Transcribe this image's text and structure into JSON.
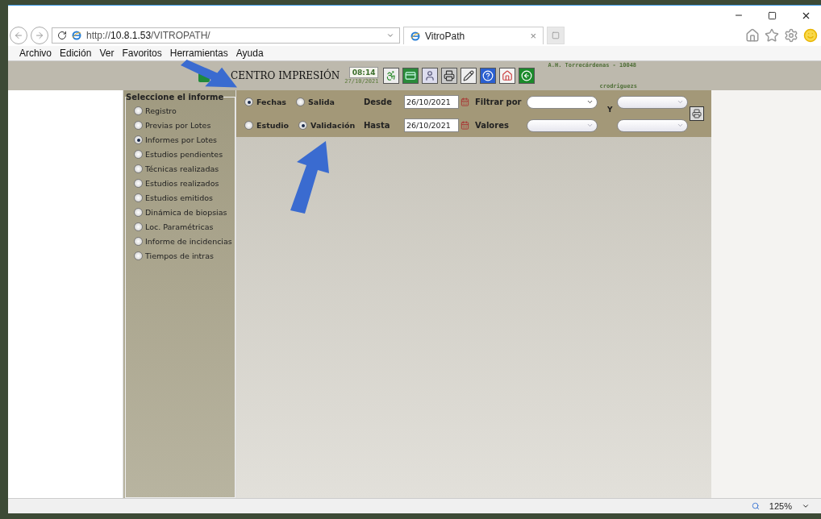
{
  "browser": {
    "url": "http://**10.8.1.53**/VITROPATH/",
    "tab": {
      "title": "VitroPath",
      "close": "×"
    },
    "menu": [
      "Archivo",
      "Edición",
      "Ver",
      "Favoritos",
      "Herramientas",
      "Ayuda"
    ],
    "zoom": "125%"
  },
  "header": {
    "title": "CENTRO IMPRESIÓN",
    "time": "08:14",
    "date": "27/10/2021",
    "facility": "A.H. Torrecárdenas - 10048",
    "user": "crodriguezs"
  },
  "sidebar": {
    "legend": "Seleccione el informe",
    "items": [
      {
        "label": "Registro",
        "selected": false
      },
      {
        "label": "Previas por Lotes",
        "selected": false
      },
      {
        "label": "Informes por Lotes",
        "selected": true
      },
      {
        "label": "Estudios pendientes",
        "selected": false
      },
      {
        "label": "Técnicas realizadas",
        "selected": false
      },
      {
        "label": "Estudios realizados",
        "selected": false
      },
      {
        "label": "Estudios emitidos",
        "selected": false
      },
      {
        "label": "Dinámica de biopsias",
        "selected": false
      },
      {
        "label": "Loc. Paramétricas",
        "selected": false
      },
      {
        "label": "Informe de incidencias",
        "selected": false
      },
      {
        "label": "Tiempos de intras",
        "selected": false
      }
    ]
  },
  "filters": {
    "rows": [
      {
        "options": [
          {
            "label": "Fechas",
            "selected": true
          },
          {
            "label": "Salida",
            "selected": false
          }
        ],
        "date_label": "Desde",
        "date": "26/10/2021",
        "select_label": "Filtrar por"
      },
      {
        "options": [
          {
            "label": "Estudio",
            "selected": false
          },
          {
            "label": "Validación",
            "selected": true
          }
        ],
        "date_label": "Hasta",
        "date": "26/10/2021",
        "select_label": "Valores"
      }
    ],
    "joiner": "Y"
  }
}
